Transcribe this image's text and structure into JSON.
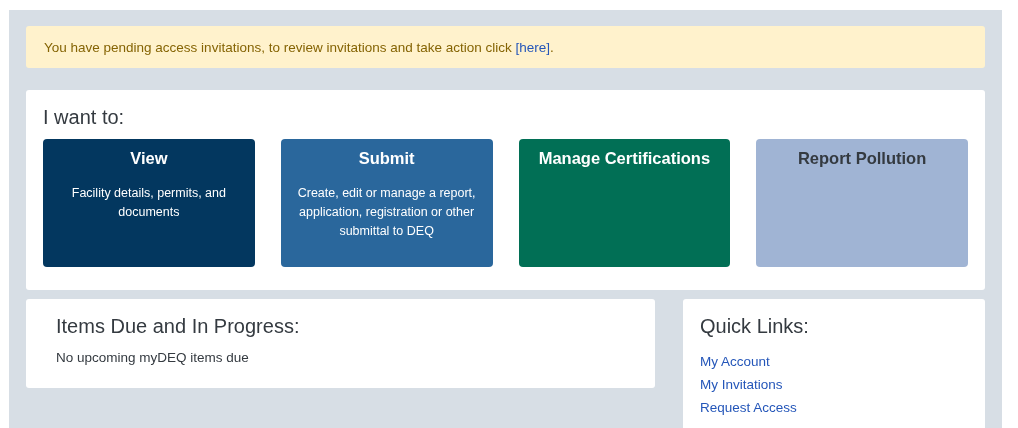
{
  "alert": {
    "text": "You have pending access invitations, to review invitations and take action click ",
    "link": "[here]",
    "text_end": "."
  },
  "actions": {
    "heading": "I want to:",
    "tiles": [
      {
        "title": "View",
        "description": "Facility details, permits, and documents",
        "color": "#03375f"
      },
      {
        "title": "Submit",
        "description": "Create, edit or manage a report, application, registration or other submittal to DEQ",
        "color": "#2a679c"
      },
      {
        "title": "Manage Certifications",
        "color": "#016f55"
      },
      {
        "title": "Report Pollution",
        "color": "#a0b4d4"
      }
    ]
  },
  "items_due": {
    "heading": "Items Due and In Progress:",
    "message": "No upcoming myDEQ items due"
  },
  "quick_links": {
    "heading": "Quick Links:",
    "links": [
      "My Account",
      "My Invitations",
      "Request Access"
    ]
  }
}
